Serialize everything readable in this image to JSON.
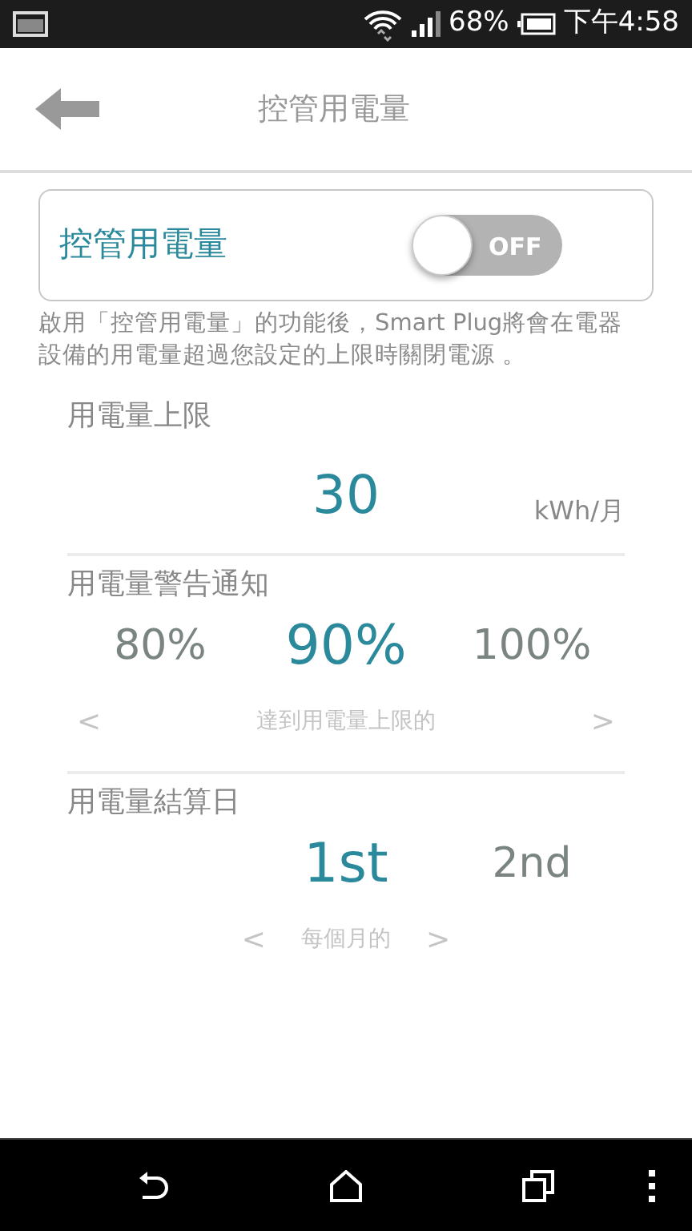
{
  "status_bar": {
    "battery": "68%",
    "time": "下午4:58"
  },
  "app_bar": {
    "title": "控管用電量"
  },
  "control": {
    "label": "控管用電量",
    "on": false,
    "toggle_label": "OFF",
    "description": "啟用「控管用電量」的功能後，Smart Plug將會在電器設備的用電量超過您設定的上限時關閉電源 。"
  },
  "limit": {
    "label": "用電量上限",
    "value": "30",
    "unit": "kWh/月"
  },
  "pickers": [
    {
      "label": "用電量警告通知",
      "options": [
        {
          "label": "80%",
          "selected": false
        },
        {
          "label": "90%",
          "selected": true
        },
        {
          "label": "100%",
          "selected": false
        }
      ],
      "prev": "<",
      "hint": "達到用電量上限的",
      "next": ">"
    },
    {
      "label": "用電量結算日",
      "options": [
        {
          "label": "1st",
          "selected": true
        },
        {
          "label": "2nd",
          "selected": false
        }
      ],
      "prev": "<",
      "hint": "每個月的",
      "next": ">"
    }
  ]
}
